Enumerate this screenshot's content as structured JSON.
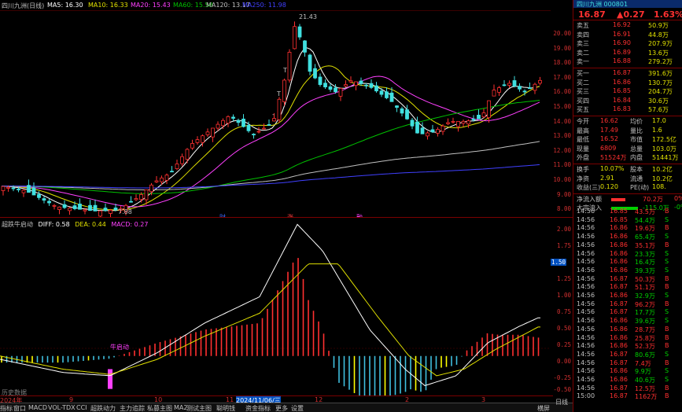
{
  "topbar": {
    "stock_name": "四川九洲(日线)",
    "ma5": "MA5: 16.30",
    "ma10": "MA10: 16.33",
    "ma20": "MA20: 15.43",
    "ma60": "MA60: 15.58",
    "ma120": "MA120: 13.17",
    "ma250": "MA250: 11.98",
    "colors": {
      "ma5": "#ffffff",
      "ma10": "#e0e000",
      "ma20": "#ff40ff",
      "ma60": "#00c000",
      "ma120": "#c0c0c0",
      "ma250": "#4040ff"
    }
  },
  "main_chart": {
    "high_label": "21.43",
    "low_label": "7.88",
    "markers": [
      "T",
      "T",
      "-",
      "财",
      "涨",
      "融"
    ],
    "price_axis": [
      "20.00",
      "19.00",
      "18.00",
      "17.00",
      "16.00",
      "15.00",
      "14.00",
      "13.00",
      "12.00",
      "11.00",
      "10.00",
      "9.00",
      "8.00"
    ],
    "price_range": [
      7.6,
      21.6
    ]
  },
  "indicator": {
    "name": "超跌牛启动",
    "diff": "DIFF: 0.58",
    "dea": "DEA: 0.44",
    "macd": "MACD: 0.27",
    "signal_label": "牛启动",
    "current_tag": "1.50",
    "axis": [
      "2.00",
      "1.75",
      "1.50",
      "1.25",
      "1.00",
      "0.75",
      "0.50",
      "0.25",
      "0.00",
      "-0.25",
      "-0.50"
    ],
    "range": [
      -0.6,
      2.1
    ]
  },
  "x_axis": {
    "labels": [
      "2024年",
      "9",
      "10",
      "11",
      "2024/11/06/三",
      "12",
      "2",
      "3"
    ],
    "bottom_note": "历史数据"
  },
  "right_panel": {
    "header": "四川九洲 000801",
    "price": "16.87",
    "change": "▲0.27",
    "pct": "1.63%",
    "asks": [
      {
        "label": "卖五",
        "price": "16.92",
        "vol": "50.9万"
      },
      {
        "label": "卖四",
        "price": "16.91",
        "vol": "44.8万"
      },
      {
        "label": "卖三",
        "price": "16.90",
        "vol": "207.9万"
      },
      {
        "label": "卖二",
        "price": "16.89",
        "vol": "13.6万"
      },
      {
        "label": "卖一",
        "price": "16.88",
        "vol": "279.2万"
      }
    ],
    "bids": [
      {
        "label": "买一",
        "price": "16.87",
        "vol": "391.6万"
      },
      {
        "label": "买二",
        "price": "16.86",
        "vol": "130.7万"
      },
      {
        "label": "买三",
        "price": "16.85",
        "vol": "204.7万"
      },
      {
        "label": "买四",
        "price": "16.84",
        "vol": "30.6万"
      },
      {
        "label": "买五",
        "price": "16.83",
        "vol": "57.6万"
      }
    ],
    "stats": [
      {
        "k1": "今开",
        "v1": "16.62",
        "k2": "均价",
        "v2": "17.0"
      },
      {
        "k1": "最高",
        "v1": "17.49",
        "k2": "量比",
        "v2": "1.6"
      },
      {
        "k1": "最低",
        "v1": "16.52",
        "k2": "市值",
        "v2": "172.5亿"
      },
      {
        "k1": "现量",
        "v1": "6809",
        "k2": "总量",
        "v2": "103.0万"
      },
      {
        "k1": "外盘",
        "v1": "51524万",
        "k2": "内盘",
        "v2": "51441万"
      }
    ],
    "stats2": [
      {
        "k1": "换手",
        "v1": "10.07%",
        "k2": "股本",
        "v2": "10.2亿"
      },
      {
        "k1": "净资",
        "v1": "2.91",
        "k2": "流通",
        "v2": "10.2亿"
      },
      {
        "k1": "收益(三)",
        "v1": "0.120",
        "k2": "PE(动)",
        "v2": "108."
      }
    ],
    "flows": [
      {
        "label": "净流入额",
        "val": "70.2万",
        "pct": "0%"
      },
      {
        "label": "大宗流入",
        "val": "-115.0万",
        "pct": "-0%"
      }
    ],
    "ticks": [
      {
        "t": "14:56",
        "p": "16.85",
        "v": "43.5万",
        "s": "B"
      },
      {
        "t": "14:56",
        "p": "16.85",
        "v": "54.4万",
        "s": "S"
      },
      {
        "t": "14:56",
        "p": "16.86",
        "v": "19.6万",
        "s": "B"
      },
      {
        "t": "14:56",
        "p": "16.86",
        "v": "65.4万",
        "s": "S"
      },
      {
        "t": "14:56",
        "p": "16.86",
        "v": "35.1万",
        "s": "B"
      },
      {
        "t": "14:56",
        "p": "16.86",
        "v": "23.3万",
        "s": "S"
      },
      {
        "t": "14:56",
        "p": "16.86",
        "v": "16.4万",
        "s": "S"
      },
      {
        "t": "14:56",
        "p": "16.86",
        "v": "39.3万",
        "s": "S"
      },
      {
        "t": "14:56",
        "p": "16.87",
        "v": "50.3万",
        "s": "B"
      },
      {
        "t": "14:56",
        "p": "16.87",
        "v": "51.1万",
        "s": "B"
      },
      {
        "t": "14:56",
        "p": "16.86",
        "v": "32.9万",
        "s": "S"
      },
      {
        "t": "14:56",
        "p": "16.87",
        "v": "96.2万",
        "s": "B"
      },
      {
        "t": "14:56",
        "p": "16.87",
        "v": "17.7万",
        "s": "S"
      },
      {
        "t": "14:56",
        "p": "16.86",
        "v": "39.6万",
        "s": "S"
      },
      {
        "t": "14:56",
        "p": "16.86",
        "v": "28.7万",
        "s": "B"
      },
      {
        "t": "14:56",
        "p": "16.86",
        "v": "25.8万",
        "s": "B"
      },
      {
        "t": "14:56",
        "p": "16.86",
        "v": "52.3万",
        "s": "B"
      },
      {
        "t": "14:56",
        "p": "16.87",
        "v": "80.6万",
        "s": "S"
      },
      {
        "t": "14:56",
        "p": "16.87",
        "v": "7.4万",
        "s": "B"
      },
      {
        "t": "14:56",
        "p": "16.86",
        "v": "9.9万",
        "s": "S"
      },
      {
        "t": "14:56",
        "p": "16.86",
        "v": "40.6万",
        "s": "S"
      },
      {
        "t": "14:56",
        "p": "16.87",
        "v": "12.5万",
        "s": "B"
      },
      {
        "t": "15:00",
        "p": "16.87",
        "v": "1162万",
        "s": "B"
      }
    ]
  },
  "tabs": [
    "指标",
    "窗口",
    "MACD",
    "VOL-TDX",
    "CCI",
    "超跌动力",
    "主力追踪",
    "私募主图",
    "MA2",
    "测试主图",
    "聪明钱",
    "资金指标",
    "更多",
    "设置"
  ],
  "tabs_right": [
    "横屏",
    "日线"
  ]
}
